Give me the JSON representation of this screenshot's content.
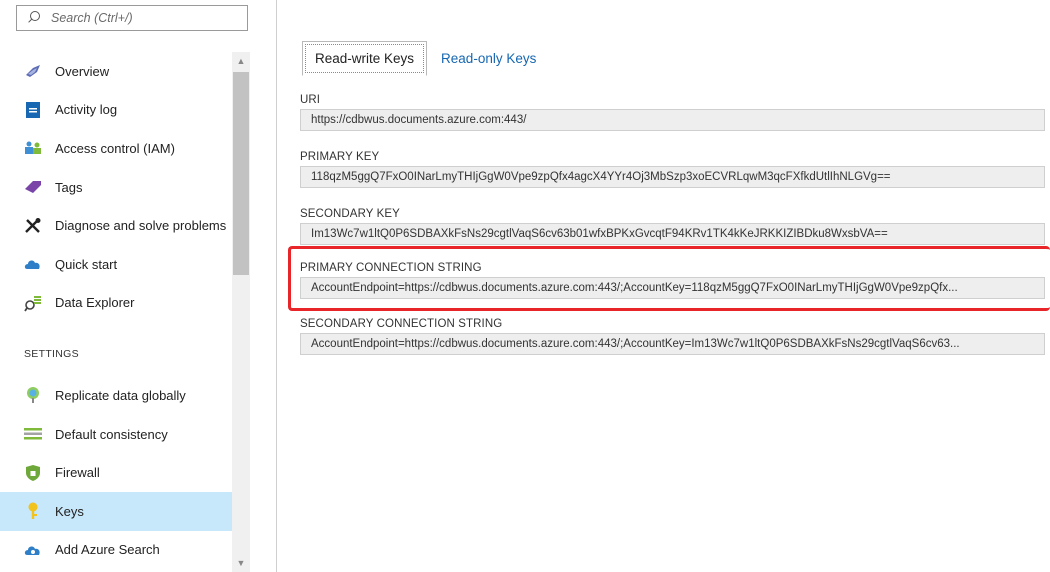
{
  "search": {
    "placeholder": "Search (Ctrl+/)"
  },
  "menu": {
    "items": [
      {
        "label": "Overview",
        "icon": "overview-icon"
      },
      {
        "label": "Activity log",
        "icon": "activity-log-icon"
      },
      {
        "label": "Access control (IAM)",
        "icon": "access-control-icon"
      },
      {
        "label": "Tags",
        "icon": "tag-icon"
      },
      {
        "label": "Diagnose and solve problems",
        "icon": "wrench-icon"
      },
      {
        "label": "Quick start",
        "icon": "cloud-icon"
      },
      {
        "label": "Data Explorer",
        "icon": "data-explorer-icon"
      }
    ],
    "settings_heading": "SETTINGS",
    "settings_items": [
      {
        "label": "Replicate data globally",
        "icon": "globe-icon"
      },
      {
        "label": "Default consistency",
        "icon": "lines-icon"
      },
      {
        "label": "Firewall",
        "icon": "firewall-icon"
      },
      {
        "label": "Keys",
        "icon": "key-icon",
        "selected": true
      },
      {
        "label": "Add Azure Search",
        "icon": "cloud-search-icon"
      }
    ]
  },
  "tabs": {
    "read_write": "Read-write Keys",
    "read_only": "Read-only Keys"
  },
  "fields": {
    "uri": {
      "label": "URI",
      "value": "https://cdbwus.documents.azure.com:443/"
    },
    "primary_key": {
      "label": "PRIMARY KEY",
      "value": "118qzM5ggQ7FxO0INarLmyTHIjGgW0Vpe9zpQfx4agcX4YYr4Oj3MbSzp3xoECVRLqwM3qcFXfkdUtlIhNLGVg=="
    },
    "secondary_key": {
      "label": "SECONDARY KEY",
      "value": "Im13Wc7w1ltQ0P6SDBAXkFsNs29cgtlVaqS6cv63b01wfxBPKxGvcqtF94KRv1TK4kKeJRKKIZIBDku8WxsbVA=="
    },
    "primary_connection": {
      "label": "PRIMARY CONNECTION STRING",
      "value": "AccountEndpoint=https://cdbwus.documents.azure.com:443/;AccountKey=118qzM5ggQ7FxO0INarLmyTHIjGgW0Vpe9zpQfx..."
    },
    "secondary_connection": {
      "label": "SECONDARY CONNECTION STRING",
      "value": "AccountEndpoint=https://cdbwus.documents.azure.com:443/;AccountKey=Im13Wc7w1ltQ0P6SDBAXkFsNs29cgtlVaqS6cv63..."
    }
  },
  "colors": {
    "selected_bg": "#c7e7fa",
    "link_blue": "#1667b0",
    "highlight_red": "#e8262a",
    "copy_button_blue": "#1778c9"
  }
}
